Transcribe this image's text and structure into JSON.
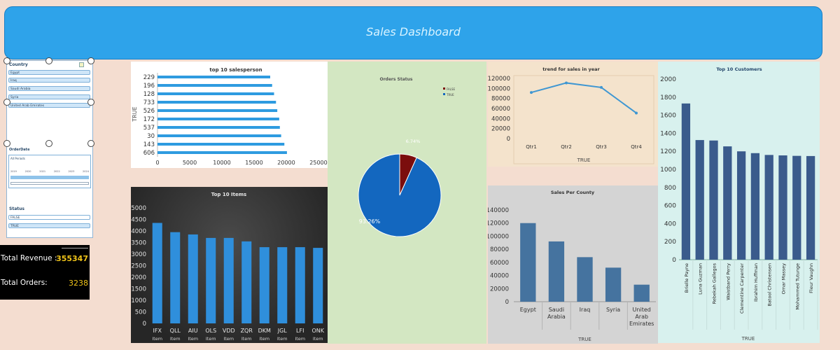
{
  "header": {
    "title": "Sales Dashboard"
  },
  "slicers": {
    "country": {
      "title": "Country",
      "items": [
        "Egypt",
        "Iraq",
        "Saudi Arabia",
        "Syria",
        "United Arab Emirates"
      ]
    },
    "timeline": {
      "title": "OrderDate",
      "period": "All Periods",
      "years": [
        "2019",
        "2020",
        "2021",
        "2022",
        "2023",
        "2024"
      ]
    },
    "status": {
      "title": "Status",
      "items": [
        "FALSE",
        "TRUE"
      ]
    }
  },
  "kpis": {
    "revenue_label": "Total Revenue :",
    "revenue_value": "355347",
    "orders_label": "Total Orders:",
    "orders_value": "3238"
  },
  "chart_data": [
    {
      "id": "salesperson",
      "type": "bar",
      "orientation": "horizontal",
      "title": "top 10 salesperson",
      "ylabel": "TRUE",
      "categories": [
        "229",
        "196",
        "128",
        "733",
        "526",
        "172",
        "537",
        "30",
        "143",
        "606"
      ],
      "values": [
        17500,
        17800,
        18100,
        18400,
        18600,
        18900,
        19000,
        19200,
        19700,
        20100
      ],
      "xlim": [
        0,
        25000
      ],
      "xticks": [
        "0",
        "5000",
        "10000",
        "15000",
        "20000",
        "25000"
      ],
      "color": "#2e9be0"
    },
    {
      "id": "orders_status",
      "type": "pie",
      "title": "Orders Status",
      "slices": [
        {
          "name": "FALSE",
          "value": 6.74,
          "label": "6.74%",
          "color": "#7b0d0d"
        },
        {
          "name": "TRUE",
          "value": 93.26,
          "label": "93.26%",
          "color": "#1367bf"
        }
      ],
      "legend": [
        "FALSE",
        "TRUE"
      ],
      "legend_position": "top-right"
    },
    {
      "id": "trend",
      "type": "line",
      "title": "trend for sales in year",
      "xlabel": "TRUE",
      "categories": [
        "Qtr1",
        "Qtr2",
        "Qtr3",
        "Qtr4"
      ],
      "values": [
        92000,
        111000,
        102000,
        51000
      ],
      "ylim": [
        0,
        120000
      ],
      "yticks": [
        "0",
        "20000",
        "40000",
        "60000",
        "80000",
        "100000",
        "120000"
      ],
      "color": "#3f97d2"
    },
    {
      "id": "customers",
      "type": "bar",
      "title": "Top 10 Customers",
      "xlabel": "TRUE",
      "categories": [
        "Brielle Payne",
        "Luna Guzman",
        "Rebekah Gallegos",
        "Waistband Perry",
        "Clementine Carpenter",
        "Ibrahim Huffman",
        "Batool Christensen",
        "Omar Massey",
        "Mohammed Tutunge",
        "Fleur Vaughn"
      ],
      "values": [
        1730,
        1325,
        1320,
        1255,
        1200,
        1180,
        1160,
        1155,
        1150,
        1148
      ],
      "ylim": [
        0,
        2000
      ],
      "yticks": [
        "0",
        "200",
        "400",
        "600",
        "800",
        "1000",
        "1200",
        "1400",
        "1600",
        "1800",
        "2000"
      ],
      "color": "#3a5b8c"
    },
    {
      "id": "items",
      "type": "bar",
      "title": "Top 10 Items",
      "categories": [
        "IFX",
        "QLL",
        "AIU",
        "OLS",
        "VDD",
        "ZQR",
        "DKM",
        "JGL",
        "LFI",
        "ONK"
      ],
      "category_sublabel": "Item",
      "values": [
        4350,
        3950,
        3850,
        3700,
        3700,
        3550,
        3300,
        3300,
        3300,
        3270
      ],
      "ylim": [
        0,
        5000
      ],
      "yticks": [
        "0",
        "500",
        "1000",
        "1500",
        "2000",
        "2500",
        "3000",
        "3500",
        "4000",
        "4500",
        "5000"
      ],
      "color": "#2f8fdc"
    },
    {
      "id": "country_sales",
      "type": "bar",
      "title": "Sales Per County",
      "xlabel": "TRUE",
      "categories": [
        "Egypt",
        "Saudi Arabia",
        "Iraq",
        "Syria",
        "United Arab Emirates"
      ],
      "values": [
        120000,
        92000,
        68000,
        52000,
        26000
      ],
      "ylim": [
        0,
        140000
      ],
      "yticks": [
        "0",
        "20000",
        "40000",
        "60000",
        "80000",
        "100000",
        "120000",
        "140000"
      ],
      "color": "#45739f"
    }
  ]
}
